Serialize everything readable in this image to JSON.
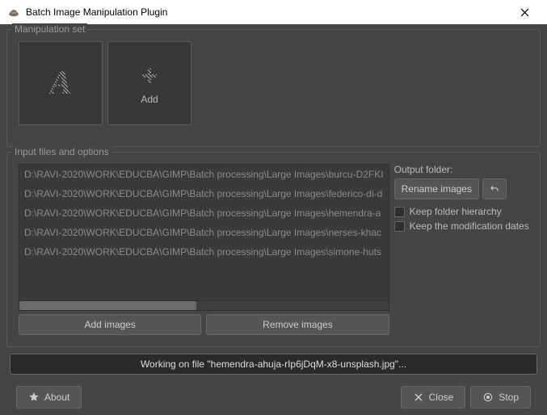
{
  "window": {
    "title": "Batch Image Manipulation Plugin"
  },
  "manip": {
    "group_label": "Manipulation set",
    "tiles": {
      "first_icon": "A",
      "add_icon": "+",
      "add_label": "Add"
    }
  },
  "io": {
    "group_label": "Input files and options",
    "files": [
      "D:\\RAVI-2020\\WORK\\EDUCBA\\GIMP\\Batch processing\\Large Images\\burcu-D2FKI",
      "D:\\RAVI-2020\\WORK\\EDUCBA\\GIMP\\Batch processing\\Large Images\\federico-di-d",
      "D:\\RAVI-2020\\WORK\\EDUCBA\\GIMP\\Batch processing\\Large Images\\hemendra-a",
      "D:\\RAVI-2020\\WORK\\EDUCBA\\GIMP\\Batch processing\\Large Images\\nerses-khac",
      "D:\\RAVI-2020\\WORK\\EDUCBA\\GIMP\\Batch processing\\Large Images\\simone-huts"
    ],
    "add_images": "Add images",
    "remove_images": "Remove images",
    "output_folder_label": "Output folder:",
    "rename_images": "Rename images",
    "keep_hierarchy": "Keep folder hierarchy",
    "keep_dates": "Keep the modification dates"
  },
  "progress": {
    "text": "Working on file \"hemendra-ahuja-rIp6jDqM-x8-unsplash.jpg\"..."
  },
  "footer": {
    "about": "About",
    "close": "Close",
    "stop": "Stop"
  }
}
